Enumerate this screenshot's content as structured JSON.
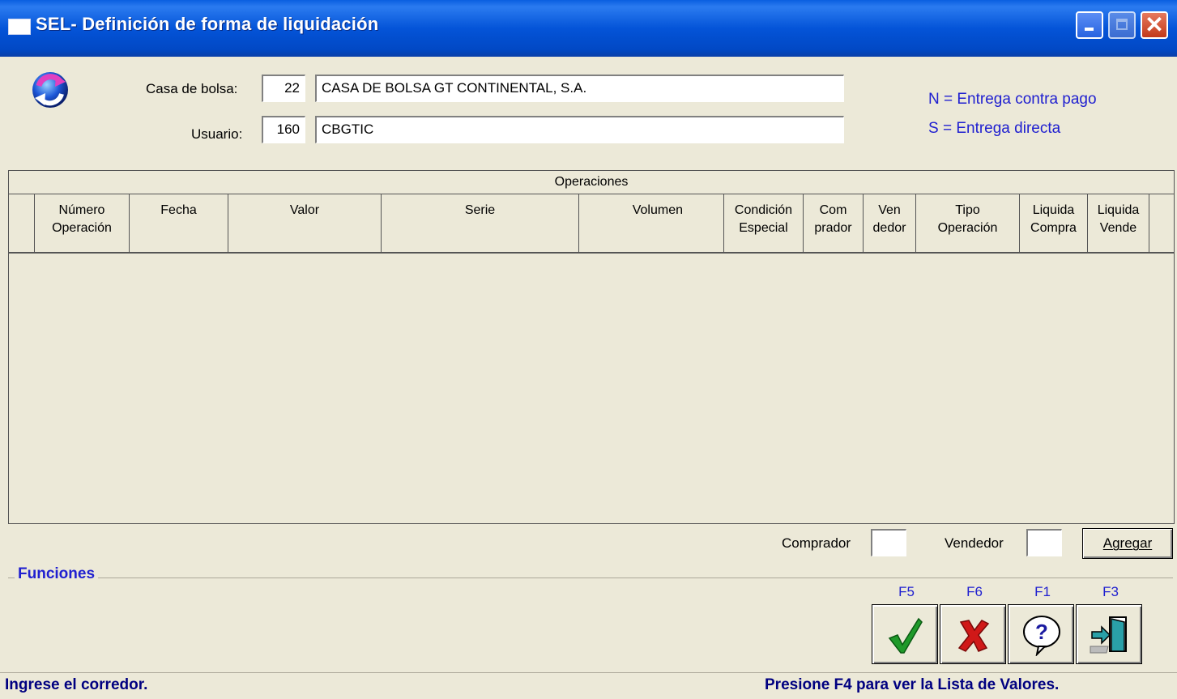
{
  "window": {
    "title": "SEL- Definición de forma de liquidación"
  },
  "header": {
    "casa_label": "Casa de bolsa:",
    "casa_code": "22",
    "casa_name": "CASA DE BOLSA GT CONTINENTAL, S.A.",
    "usuario_label": "Usuario:",
    "usuario_code": "160",
    "usuario_name": "CBGTIC",
    "legend_n": "N = Entrega contra pago",
    "legend_s": "S = Entrega directa"
  },
  "grid": {
    "caption": "Operaciones",
    "columns": [
      "",
      "Número\nOperación",
      "Fecha",
      "Valor",
      "Serie",
      "Volumen",
      "Condición\nEspecial",
      "Com\nprador",
      "Ven\ndedor",
      "Tipo\nOperación",
      "Liquida\nCompra",
      "Liquida\nVende"
    ]
  },
  "bottom": {
    "comprador_label": "Comprador",
    "vendedor_label": "Vendedor",
    "agregar_label": "Agregar"
  },
  "funciones": {
    "title": "Funciones",
    "keys": [
      "F5",
      "F6",
      "F1",
      "F3"
    ]
  },
  "status": {
    "left": "Ingrese el corredor.",
    "right": "Presione F4 para ver la Lista de Valores."
  },
  "colors": {
    "titlebar": "#0454d8",
    "accent_text": "#2020d0",
    "status_text": "#000080",
    "background": "#ece9d8"
  }
}
